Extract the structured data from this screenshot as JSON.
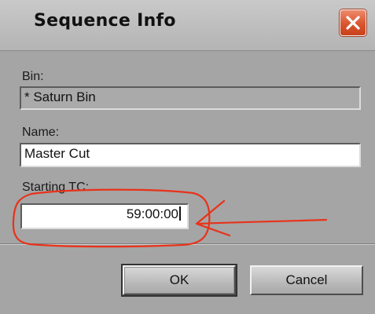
{
  "dialog": {
    "title": "Sequence Info",
    "close_icon": "close-x-icon"
  },
  "fields": {
    "bin_label": "Bin:",
    "bin_value": "* Saturn Bin",
    "name_label": "Name:",
    "name_value": "Master Cut",
    "tc_label": "Starting TC:",
    "tc_value": "59:00:00"
  },
  "buttons": {
    "ok_label": "OK",
    "cancel_label": "Cancel"
  },
  "annotation": {
    "color": "#e8321a",
    "shape": "hand-drawn circle and arrow pointing to Starting TC field"
  }
}
